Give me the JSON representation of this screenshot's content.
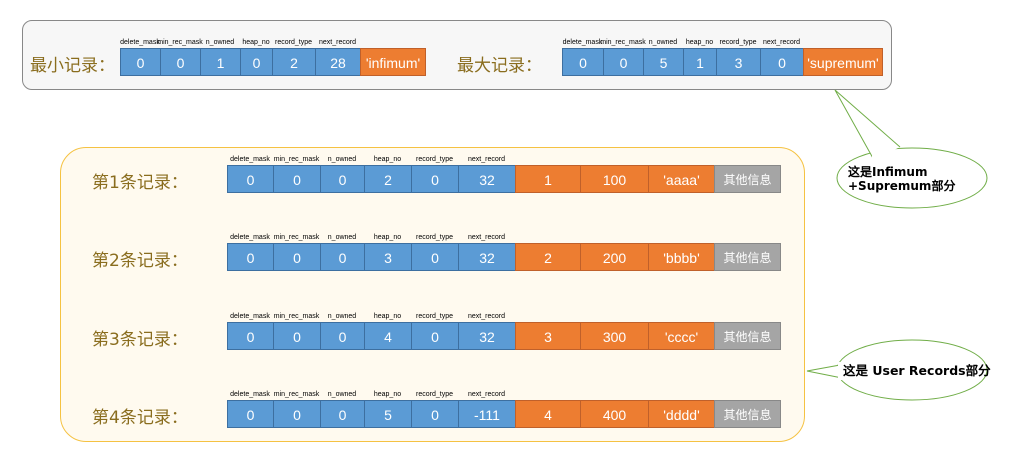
{
  "fields": [
    "delete_mask",
    "min_rec_mask",
    "n_owned",
    "heap_no",
    "record_type",
    "next_record"
  ],
  "infimum": {
    "label": "最小记录：",
    "values": [
      "0",
      "0",
      "1",
      "0",
      "2",
      "28"
    ],
    "name": "'infimum'"
  },
  "supremum": {
    "label": "最大记录：",
    "values": [
      "0",
      "0",
      "5",
      "1",
      "3",
      "0"
    ],
    "name": "'supremum'"
  },
  "records": [
    {
      "label": "第1条记录：",
      "values": [
        "0",
        "0",
        "0",
        "2",
        "0",
        "32"
      ],
      "cols": [
        "1",
        "100",
        "'aaaa'"
      ],
      "other": "其他信息"
    },
    {
      "label": "第2条记录：",
      "values": [
        "0",
        "0",
        "0",
        "3",
        "0",
        "32"
      ],
      "cols": [
        "2",
        "200",
        "'bbbb'"
      ],
      "other": "其他信息"
    },
    {
      "label": "第3条记录：",
      "values": [
        "0",
        "0",
        "0",
        "4",
        "0",
        "32"
      ],
      "cols": [
        "3",
        "300",
        "'cccc'"
      ],
      "other": "其他信息"
    },
    {
      "label": "第4条记录：",
      "values": [
        "0",
        "0",
        "0",
        "5",
        "0",
        "-111"
      ],
      "cols": [
        "4",
        "400",
        "'dddd'"
      ],
      "other": "其他信息"
    }
  ],
  "callouts": {
    "top": "这是Infimum +Supremum部分",
    "bottom": "这是 User Records部分"
  },
  "colors": {
    "header": "#5b9bd5",
    "user_data": "#ed7d31",
    "other": "#a5a5a5",
    "callout": "#70ad47"
  }
}
